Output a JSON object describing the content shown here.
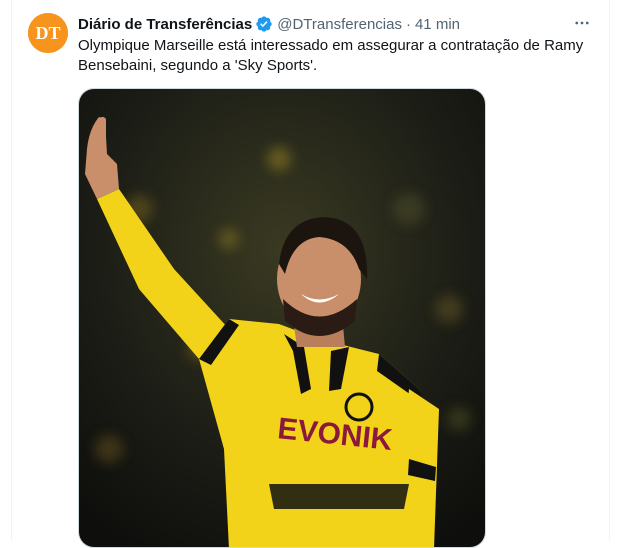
{
  "account": {
    "display_name": "Diário de Transferências",
    "handle": "@DTransferencias",
    "separator": "·",
    "timestamp": "41 min",
    "verified": true,
    "avatar_initials": "DT",
    "avatar_color": "#f7941d"
  },
  "tweet": {
    "text": "Olympique Marseille está interessado em assegurar a contratação de Ramy Bensebaini, segundo a 'Sky Sports'."
  },
  "media": {
    "jersey_sponsor": "EVONIK",
    "jersey_color": "#f2d31a"
  },
  "icons": {
    "verified": "verified-badge-icon",
    "more": "more-options-icon"
  }
}
